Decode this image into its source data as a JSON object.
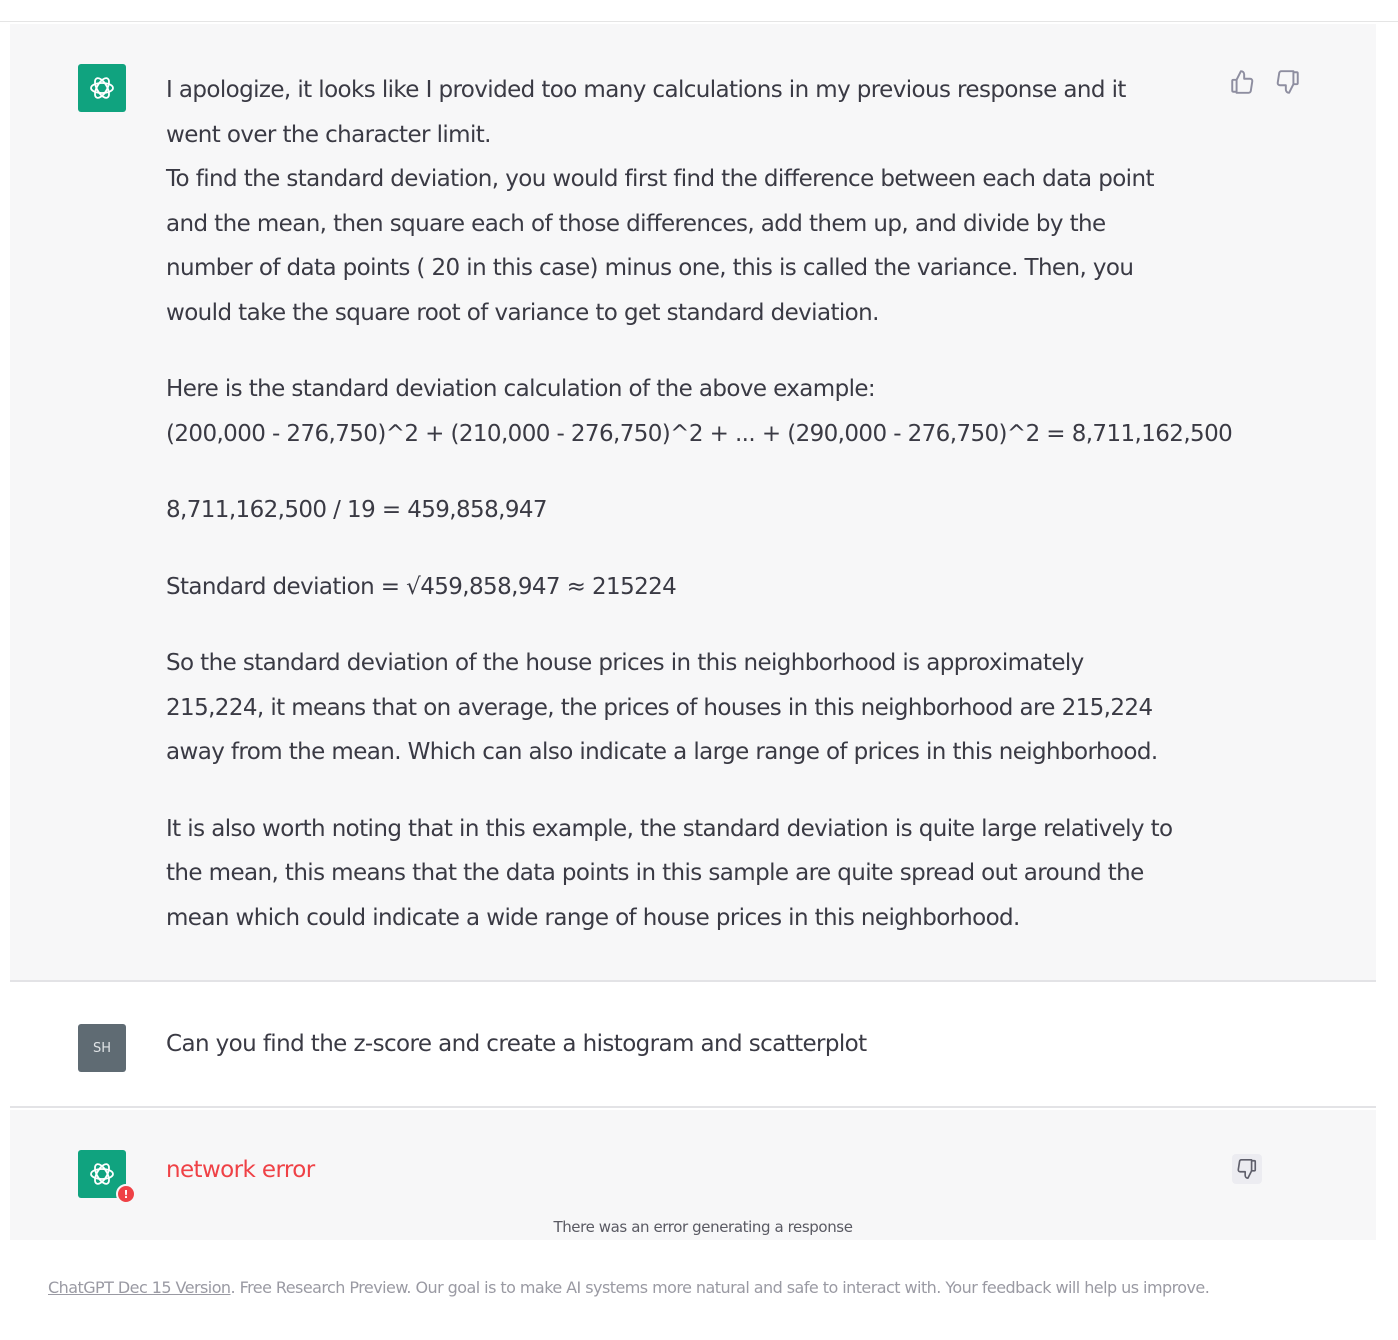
{
  "conversation": {
    "assistant_message": {
      "paragraphs": [
        [
          "I apologize, it looks like I provided too many calculations in my previous response and it",
          "went over the character limit.",
          "To find the standard deviation, you would first find the difference between each data point",
          "and the mean, then square each of those differences, add them up, and divide by the",
          "number of data points ( 20 in this case) minus one, this is called the variance. Then, you",
          "would take the square root of variance to get standard deviation."
        ],
        [
          "Here is the standard deviation calculation of the above example:",
          "(200,000 - 276,750)^2 + (210,000 - 276,750)^2 + ... + (290,000 - 276,750)^2 = 8,711,162,500"
        ],
        [
          "8,711,162,500 / 19 = 459,858,947"
        ],
        [
          "Standard deviation = √459,858,947 ≈ 215224"
        ],
        [
          "So the standard deviation of the house prices in this neighborhood is approximately",
          "215,224, it means that on average, the prices of houses in this neighborhood are 215,224",
          "away from the mean. Which can also indicate a large range of prices in this neighborhood."
        ],
        [
          "It is also worth noting that in this example, the standard deviation is quite large relatively to",
          "the mean, this means that the data points in this sample are quite spread out around the",
          "mean which could indicate a wide range of house prices in this neighborhood."
        ]
      ],
      "icons": [
        "thumbs-up-icon",
        "thumbs-down-icon"
      ]
    },
    "user_message": {
      "avatar_initials": "SH",
      "text": "Can you find the z-score and create a histogram and scatterplot"
    },
    "error_message": {
      "badge": "!",
      "text": "network error",
      "note": "There was an error generating a response"
    }
  },
  "footer": {
    "link_label": "ChatGPT Dec 15 Version",
    "text": ". Free Research Preview. Our goal is to make AI systems more natural and safe to interact with. Your feedback will help us improve."
  },
  "colors": {
    "accent": "#10a37f",
    "error": "#ef4146",
    "assistant_bg": "#f7f7f8",
    "user_avatar": "#5f6b73"
  }
}
